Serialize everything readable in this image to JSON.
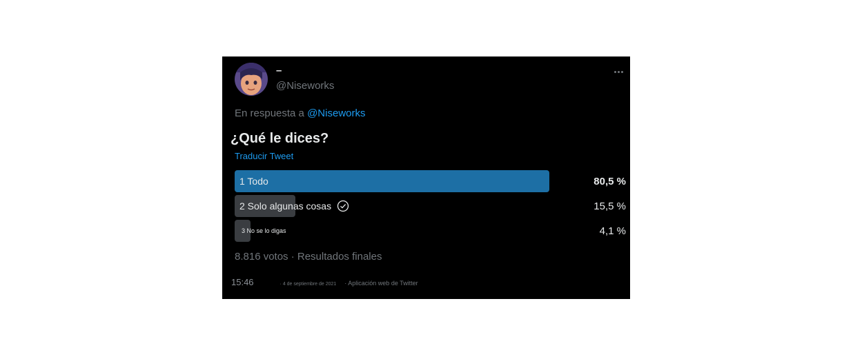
{
  "tweet": {
    "display_name": "–",
    "handle": "@Niseworks",
    "reply_prefix": "En respuesta a",
    "reply_mention": "@Niseworks",
    "text": "¿Qué le dices?",
    "translate_label": "Traducir Tweet",
    "more_icon": "more-horizontal-icon"
  },
  "poll": {
    "options": [
      {
        "label": "1 Todo",
        "percent_label": "80,5 %",
        "percent": 80.5,
        "winner": true,
        "color": "#1d6fa5"
      },
      {
        "label": "2 Solo algunas cosas",
        "percent_label": "15,5 %",
        "percent": 15.5,
        "winner": false,
        "voted": true,
        "color": "#3a3d41"
      },
      {
        "label": "3 No se lo digas",
        "percent_label": "4,1 %",
        "percent": 4.1,
        "winner": false,
        "color": "#3a3d41"
      }
    ],
    "summary": "8.816 votos · Resultados finales"
  },
  "footer": {
    "time": "15:46",
    "date": "· 4 de septiembre de 2021",
    "source": "· Aplicación web de Twitter"
  },
  "colors": {
    "background": "#000000",
    "accent": "#1d9bf0",
    "muted": "#71767b",
    "text": "#e7e9ea"
  }
}
